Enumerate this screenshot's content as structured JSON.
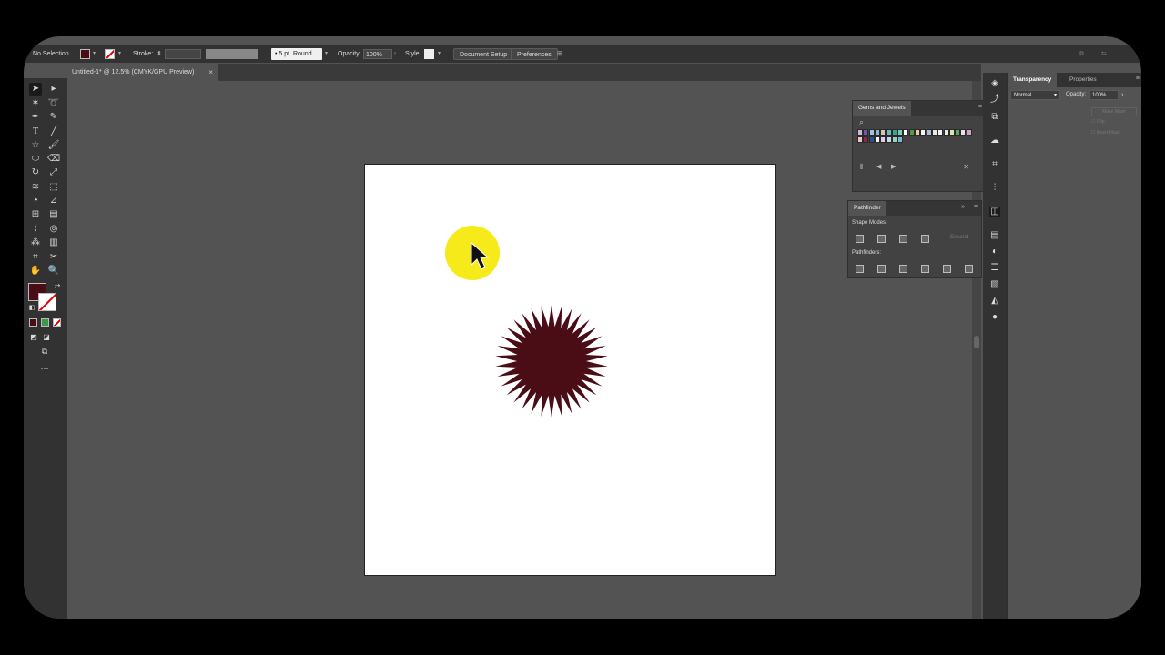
{
  "control_bar": {
    "selection_label": "No Selection",
    "stroke_label": "Stroke:",
    "brush_value": "5 pt. Round",
    "opacity_label": "Opacity:",
    "opacity_value": "100%",
    "style_label": "Style:",
    "document_setup_label": "Document Setup",
    "preferences_label": "Preferences"
  },
  "document": {
    "tab_title": "Untitled-1* @ 12.5% (CMYK/GPU Preview)",
    "close_glyph": "×"
  },
  "colors": {
    "fill": "#4a0d16",
    "shape_fill": "#4a0d16",
    "cursor_highlight": "#f7ea1b"
  },
  "swatches_panel": {
    "title": "Gems and Jewels",
    "search_glyph": "⌕",
    "swatches": [
      "#c7b8e0",
      "#6d5aa8",
      "#9cc3e6",
      "#8bb5d8",
      "#d3c8a8",
      "#6fb7c4",
      "#3aa690",
      "#7ec6c1",
      "#ffffff",
      "#4e9a52",
      "#f0c8a0",
      "#f4f4f4",
      "#a8c0d8",
      "#e8e8e8",
      "#f2f2f2",
      "#eaeaea",
      "#d6e8a8",
      "#5da85d",
      "#e8e0f0",
      "#d4a0c8",
      "#f4c0c8",
      "#8a2a4a",
      "#2f4f8a",
      "#f6f6f6",
      "#d8d0e8",
      "#c8d8f0",
      "#9bd0c0",
      "#7ab8d8"
    ]
  },
  "pathfinder_panel": {
    "title": "Pathfinder",
    "shape_modes_label": "Shape Modes:",
    "expand_label": "Expand",
    "pathfinders_label": "Pathfinders:"
  },
  "right_panel": {
    "tab_transparency": "Transparency",
    "tab_properties": "Properties",
    "blend_mode": "Normal",
    "opacity_label": "Opacity:",
    "opacity_value": "100%",
    "make_mask_label": "Make Mask",
    "clip_label": "Clip",
    "invert_mask_label": "Invert Mask"
  }
}
